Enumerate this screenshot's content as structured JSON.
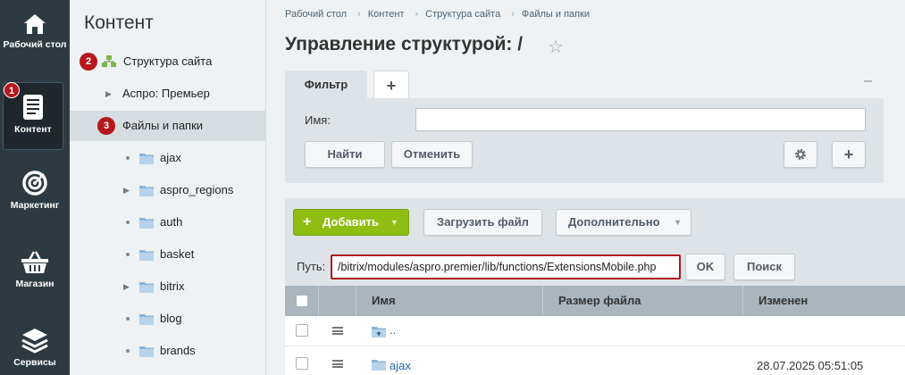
{
  "nav": {
    "items": [
      {
        "label": "Рабочий стол",
        "icon": "home-icon"
      },
      {
        "label": "Контент",
        "icon": "document-icon"
      },
      {
        "label": "Маркетинг",
        "icon": "target-icon"
      },
      {
        "label": "Магазин",
        "icon": "basket-icon"
      },
      {
        "label": "Сервисы",
        "icon": "layers-icon"
      }
    ],
    "badge": "1"
  },
  "tree": {
    "title": "Контент",
    "site_structure": {
      "label": "Структура сайта",
      "badge": "2"
    },
    "site_name": "Аспро: Премьер",
    "files": {
      "label": "Файлы и папки",
      "badge": "3"
    },
    "folders": [
      "ajax",
      "aspro_regions",
      "auth",
      "basket",
      "bitrix",
      "blog",
      "brands"
    ],
    "folders_with_children": [
      "aspro_regions",
      "bitrix"
    ]
  },
  "breadcrumbs": [
    "Рабочий стол",
    "Контент",
    "Структура сайта",
    "Файлы и папки"
  ],
  "page_title": "Управление структурой: /",
  "filter": {
    "tab_label": "Фильтр",
    "add_tab": "+",
    "collapse": "–",
    "name_label": "Имя:",
    "name_value": "",
    "find_button": "Найти",
    "cancel_button": "Отменить",
    "add_button": "+"
  },
  "toolbar": {
    "add_button": "Добавить",
    "upload_button": "Загрузить файл",
    "more_button": "Дополнительно",
    "path_label": "Путь:",
    "path_value": "/bitrix/modules/aspro.premier/lib/functions/ExtensionsMobile.php",
    "ok_button": "OK",
    "search_button": "Поиск"
  },
  "table": {
    "columns": [
      "Имя",
      "Размер файла",
      "Изменен"
    ],
    "rows": [
      {
        "name": "..",
        "size": "",
        "modified": ""
      },
      {
        "name": "ajax",
        "size": "",
        "modified": "28.07.2025 05:51:05"
      }
    ]
  },
  "colors": {
    "accent_red": "#b6171d",
    "green": "#8fbe13",
    "nav_bg": "#2e3a41",
    "link": "#2067b0"
  }
}
